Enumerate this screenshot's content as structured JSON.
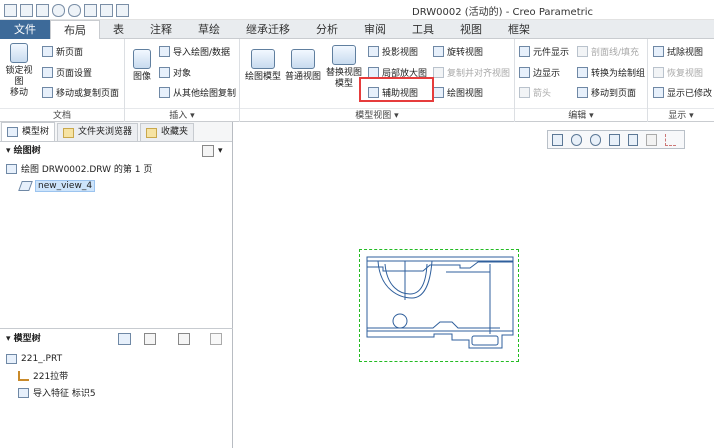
{
  "window": {
    "title": "DRW0002 (活动的) - Creo Parametric"
  },
  "quick_access": [
    "new-icon",
    "open-icon",
    "save-icon",
    "undo-icon",
    "redo-icon",
    "window-icon",
    "regenerate-icon",
    "close-icon"
  ],
  "tabs": [
    "文件",
    "布局",
    "表",
    "注释",
    "草绘",
    "继承迁移",
    "分析",
    "审阅",
    "工具",
    "视图",
    "框架"
  ],
  "active_tab": "布局",
  "ribbon": {
    "doc_group": {
      "label": "文档",
      "move_button": "锁定视图\n移动",
      "new_page": "新页面",
      "page_setup": "页面设置",
      "move_copy_page": "移动或复制页面"
    },
    "insert_group": {
      "label": "插入 ▾",
      "image": "图像",
      "import_drawing": "导入绘图/数据",
      "object": "对象",
      "from_other": "从其他绘图复制"
    },
    "model_view_group": {
      "label": "模型视图 ▾",
      "drawing_model": "绘图模型",
      "general_view": "普通视图",
      "replace_model": "替换视图\n模型",
      "projection_view": "投影视图",
      "partial_enlarge": "局部放大图",
      "aux_view": "辅助视图",
      "revolve_view": "旋转视图",
      "copy_align_view": "复制并对齐视图",
      "drawing_view": "绘图视图"
    },
    "edit_group": {
      "label": "编辑 ▾",
      "element_display": "元件显示",
      "section_line": "剖面线/填充",
      "border_display": "边显示",
      "convert_draft": "转换为绘制组",
      "arrow": "箭头",
      "move_to_page": "移动到页面"
    },
    "display_group": {
      "label": "显示 ▾",
      "erase_view": "拭除视图",
      "resume_view": "恢复视图",
      "show_erased": "显示已修改"
    }
  },
  "left_panel": {
    "tabs": [
      "模型树",
      "文件夹浏览器",
      "收藏夹"
    ],
    "drawing_tree_title": "绘图树",
    "drawing_tree_items": [
      "绘图 DRW0002.DRW 的第 1 页",
      "new_view_4"
    ],
    "model_tree_title": "模型树",
    "model_tree_items": [
      "221_.PRT",
      "221拉带",
      "导入特征 标识5"
    ]
  },
  "view_toolbar": [
    "refit-icon",
    "zoom-in-icon",
    "zoom-out-icon",
    "repaint-icon",
    "display-style-icon",
    "named-view-icon",
    "datum-display-icon"
  ],
  "colors": {
    "file_tab": "#3d6a99",
    "highlight": "#e63c3c",
    "drawing_line": "#2f5f9c",
    "view_border": "#22bb22"
  }
}
